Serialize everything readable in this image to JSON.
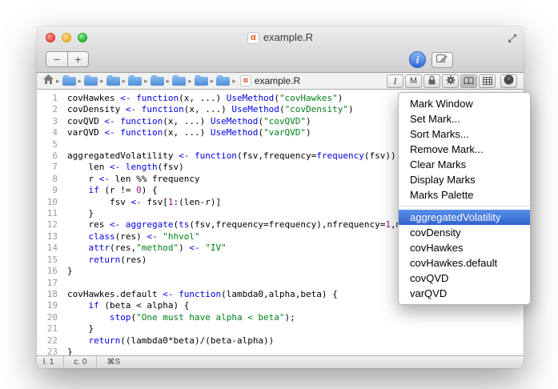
{
  "colors": {
    "keyword": "#0000e0",
    "string": "#008018",
    "number": "#9c0d9c",
    "selection_top": "#5a8fe8",
    "selection_bottom": "#2f63ce"
  },
  "window": {
    "title": "example.R",
    "file_icon_letter": "α"
  },
  "toolbar": {
    "minus_label": "−",
    "plus_label": "+",
    "info_label": "i"
  },
  "pathbar": {
    "chevron": "▸",
    "filename": "example.R",
    "file_icon_letter": "α",
    "italic_i_label": "I",
    "m_label": "M"
  },
  "editor": {
    "lines": [
      [
        [
          "p",
          "covHawkes "
        ],
        [
          "k",
          "<-"
        ],
        [
          "p",
          " "
        ],
        [
          "k",
          "function"
        ],
        [
          "p",
          "(x, ...) "
        ],
        [
          "k",
          "UseMethod"
        ],
        [
          "p",
          "("
        ],
        [
          "s",
          "\"covHawkes\""
        ],
        [
          "p",
          ")"
        ]
      ],
      [
        [
          "p",
          "covDensity "
        ],
        [
          "k",
          "<-"
        ],
        [
          "p",
          " "
        ],
        [
          "k",
          "function"
        ],
        [
          "p",
          "(x, ...) "
        ],
        [
          "k",
          "UseMethod"
        ],
        [
          "p",
          "("
        ],
        [
          "s",
          "\"covDensity\""
        ],
        [
          "p",
          ")"
        ]
      ],
      [
        [
          "p",
          "covQVD "
        ],
        [
          "k",
          "<-"
        ],
        [
          "p",
          " "
        ],
        [
          "k",
          "function"
        ],
        [
          "p",
          "(x, ...) "
        ],
        [
          "k",
          "UseMethod"
        ],
        [
          "p",
          "("
        ],
        [
          "s",
          "\"covQVD\""
        ],
        [
          "p",
          ")"
        ]
      ],
      [
        [
          "p",
          "varQVD "
        ],
        [
          "k",
          "<-"
        ],
        [
          "p",
          " "
        ],
        [
          "k",
          "function"
        ],
        [
          "p",
          "(x, ...) "
        ],
        [
          "k",
          "UseMethod"
        ],
        [
          "p",
          "("
        ],
        [
          "s",
          "\"varQVD\""
        ],
        [
          "p",
          ")"
        ]
      ],
      [],
      [
        [
          "p",
          "aggregatedVolatility "
        ],
        [
          "k",
          "<-"
        ],
        [
          "p",
          " "
        ],
        [
          "k",
          "function"
        ],
        [
          "p",
          "(fsv,frequency="
        ],
        [
          "k",
          "frequency"
        ],
        [
          "p",
          "(fsv)) {"
        ]
      ],
      [
        [
          "p",
          "    len "
        ],
        [
          "k",
          "<-"
        ],
        [
          "p",
          " "
        ],
        [
          "k",
          "length"
        ],
        [
          "p",
          "(fsv)"
        ]
      ],
      [
        [
          "p",
          "    r "
        ],
        [
          "k",
          "<-"
        ],
        [
          "p",
          " len %% frequency"
        ]
      ],
      [
        [
          "p",
          "    "
        ],
        [
          "k",
          "if"
        ],
        [
          "p",
          " (r != "
        ],
        [
          "n",
          "0"
        ],
        [
          "p",
          ") {"
        ]
      ],
      [
        [
          "p",
          "        fsv "
        ],
        [
          "k",
          "<-"
        ],
        [
          "p",
          " fsv["
        ],
        [
          "n",
          "1"
        ],
        [
          "p",
          ":(len-r)]"
        ]
      ],
      [
        [
          "p",
          "    }"
        ]
      ],
      [
        [
          "p",
          "    res "
        ],
        [
          "k",
          "<-"
        ],
        [
          "p",
          " "
        ],
        [
          "k",
          "aggregate"
        ],
        [
          "p",
          "("
        ],
        [
          "k",
          "ts"
        ],
        [
          "p",
          "(fsv,frequency=frequency),nfrequency="
        ],
        [
          "n",
          "1"
        ],
        [
          "p",
          ",mean"
        ]
      ],
      [
        [
          "p",
          "    "
        ],
        [
          "k",
          "class"
        ],
        [
          "p",
          "(res) "
        ],
        [
          "k",
          "<-"
        ],
        [
          "p",
          " "
        ],
        [
          "s",
          "\"hhvol\""
        ]
      ],
      [
        [
          "p",
          "    "
        ],
        [
          "k",
          "attr"
        ],
        [
          "p",
          "(res,"
        ],
        [
          "s",
          "\"method\""
        ],
        [
          "p",
          ") "
        ],
        [
          "k",
          "<-"
        ],
        [
          "p",
          " "
        ],
        [
          "s",
          "\"IV\""
        ]
      ],
      [
        [
          "p",
          "    "
        ],
        [
          "k",
          "return"
        ],
        [
          "p",
          "(res)"
        ]
      ],
      [
        [
          "p",
          "}"
        ]
      ],
      [],
      [
        [
          "p",
          "covHawkes.default "
        ],
        [
          "k",
          "<-"
        ],
        [
          "p",
          " "
        ],
        [
          "k",
          "function"
        ],
        [
          "p",
          "(lambda0,alpha,beta) {"
        ]
      ],
      [
        [
          "p",
          "    "
        ],
        [
          "k",
          "if"
        ],
        [
          "p",
          " (beta < alpha) {"
        ]
      ],
      [
        [
          "p",
          "        "
        ],
        [
          "k",
          "stop"
        ],
        [
          "p",
          "("
        ],
        [
          "s",
          "\"One must have alpha < beta\""
        ],
        [
          "p",
          ");"
        ]
      ],
      [
        [
          "p",
          "    }"
        ]
      ],
      [
        [
          "p",
          "    "
        ],
        [
          "k",
          "return"
        ],
        [
          "p",
          "((lambda0*beta)/(beta-alpha))"
        ]
      ],
      [
        [
          "p",
          "}"
        ]
      ]
    ]
  },
  "menu": {
    "items": [
      {
        "label": "Mark Window"
      },
      {
        "label": "Set Mark..."
      },
      {
        "label": "Sort Marks..."
      },
      {
        "label": "Remove Mark..."
      },
      {
        "label": "Clear Marks"
      },
      {
        "label": "Display Marks"
      },
      {
        "label": "Marks Palette"
      },
      {
        "separator": true
      },
      {
        "label": "aggregatedVolatility",
        "selected": true
      },
      {
        "label": "covDensity"
      },
      {
        "label": "covHawkes"
      },
      {
        "label": "covHawkes.default"
      },
      {
        "label": "covQVD"
      },
      {
        "label": "varQVD"
      }
    ]
  },
  "statusbar": {
    "line": "l. 1",
    "col": "c. 0",
    "shortcut": "⌘S"
  }
}
